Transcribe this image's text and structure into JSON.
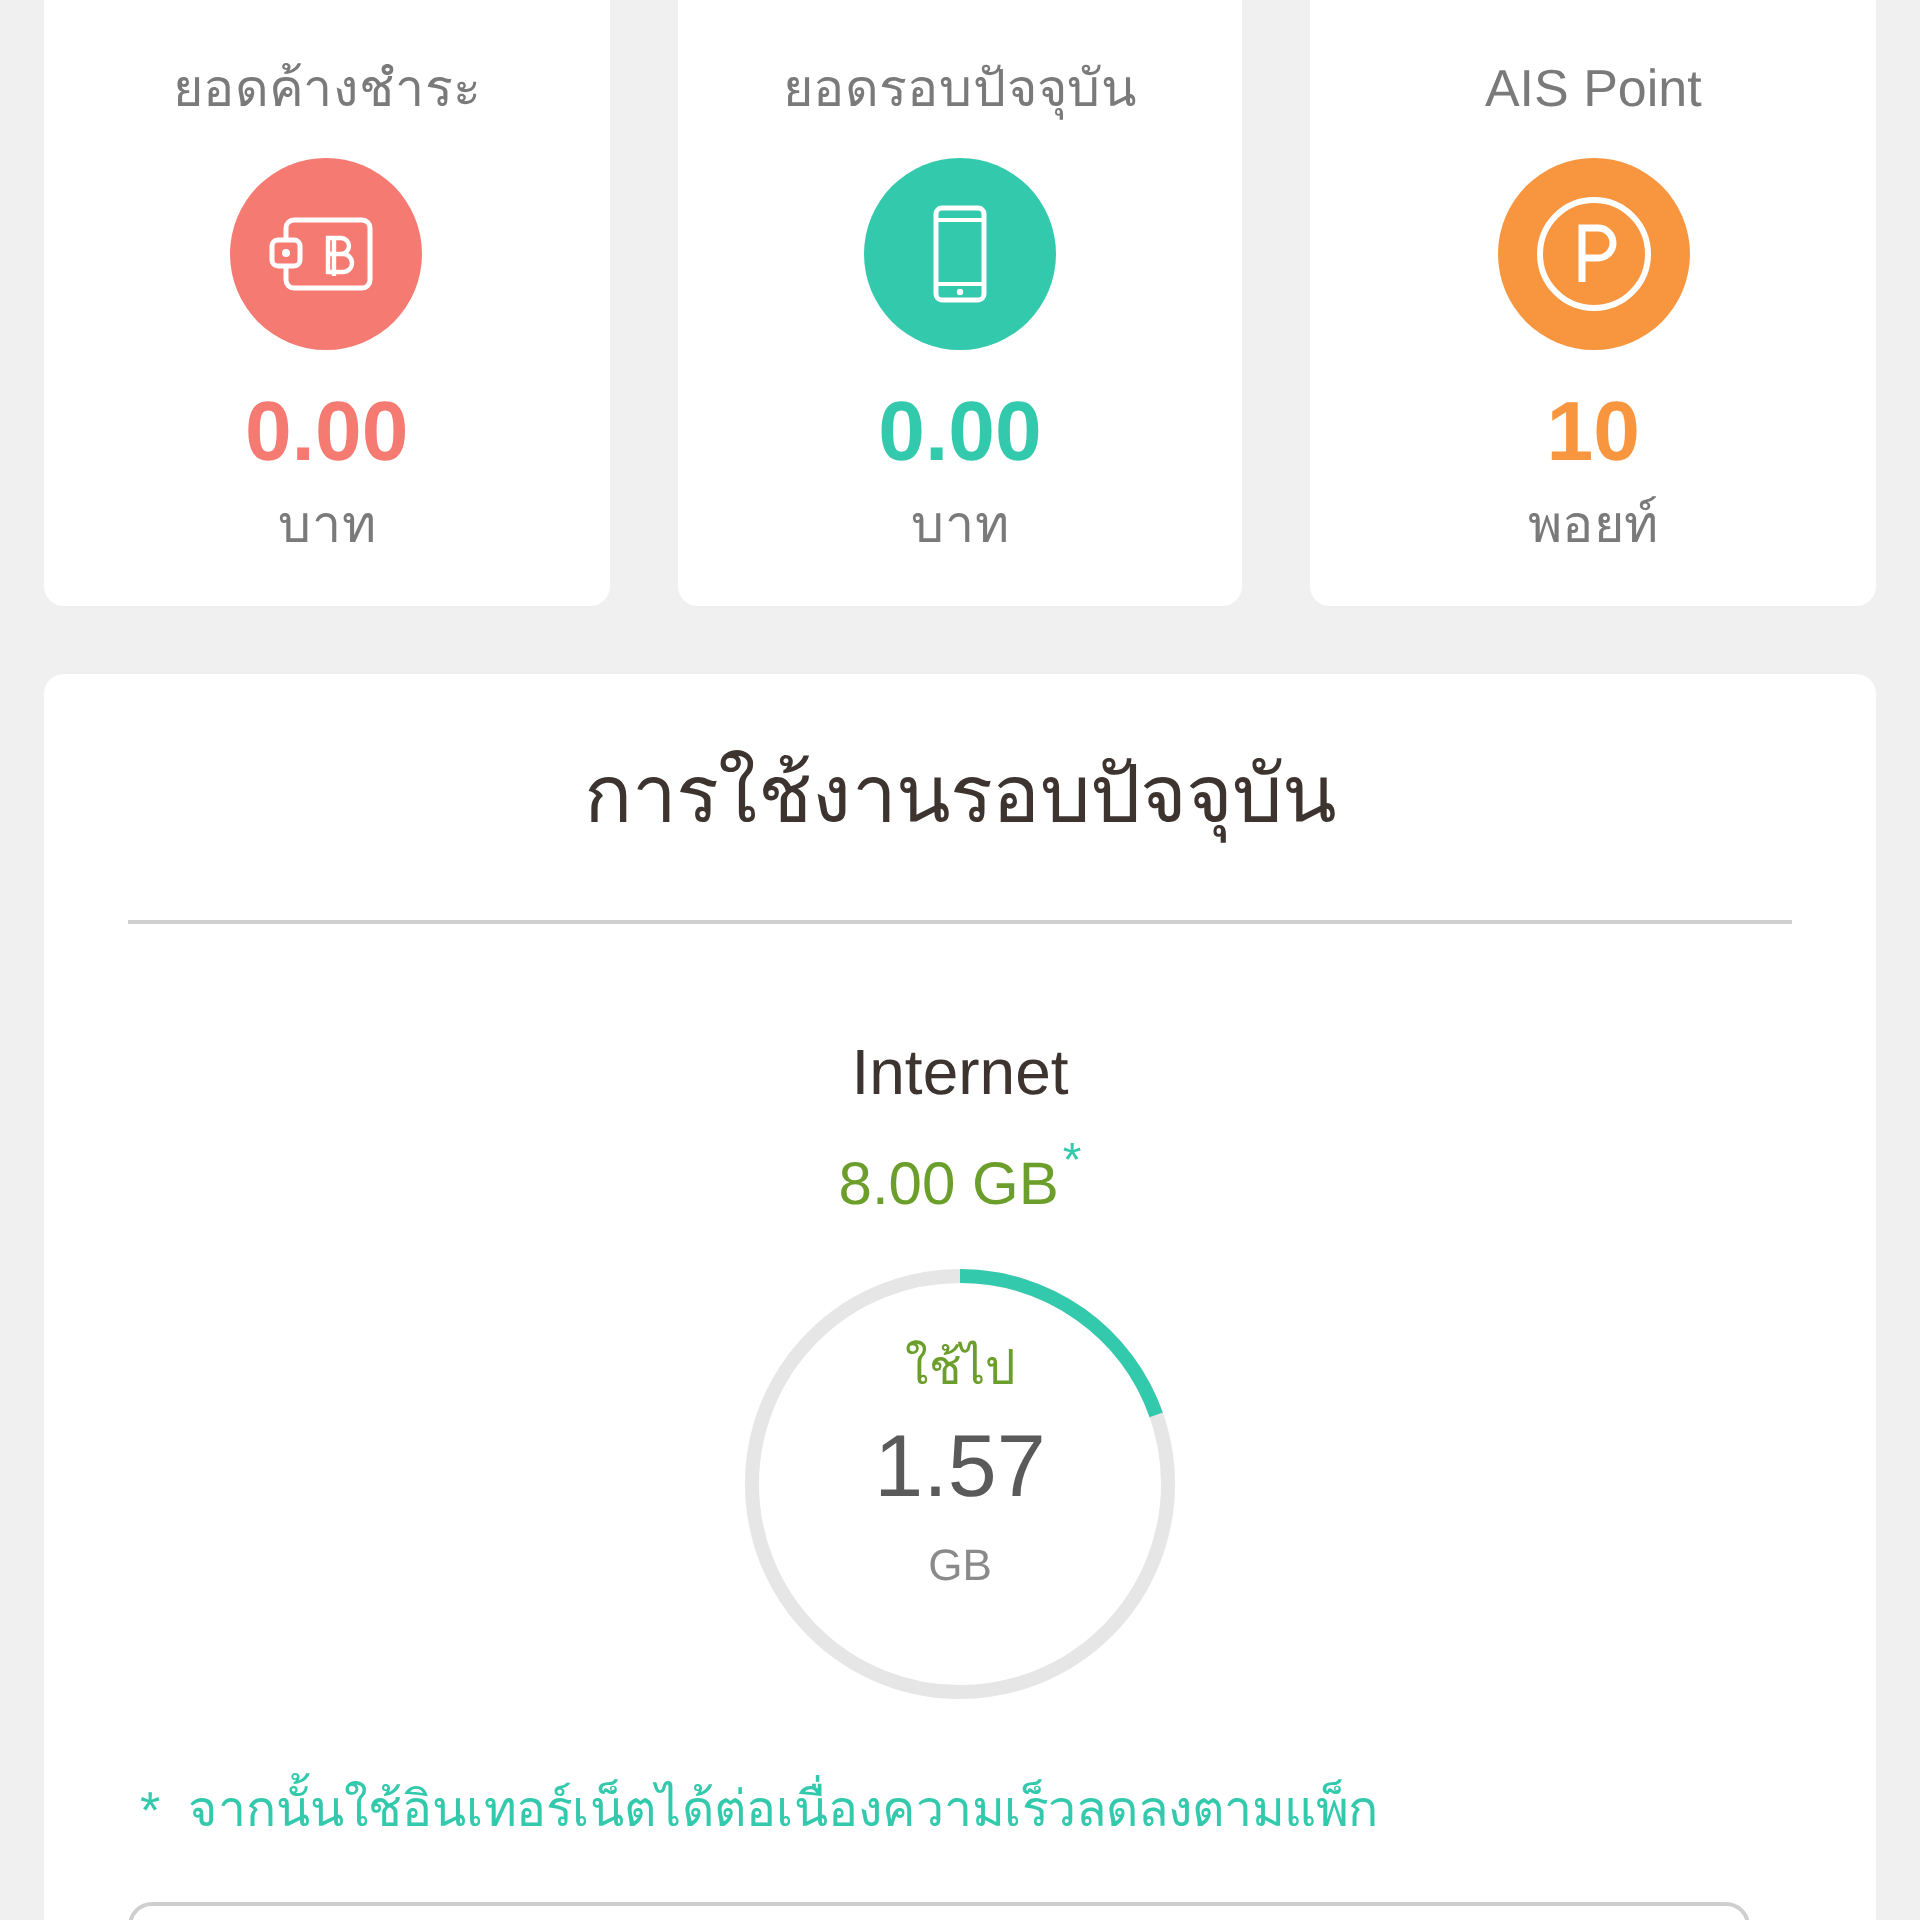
{
  "cards": [
    {
      "kind": "wallet",
      "title": "ยอดค้างชำระ",
      "value": "0.00",
      "unit": "บาท",
      "color": "#f47a72"
    },
    {
      "kind": "phone",
      "title": "ยอดรอบปัจจุบัน",
      "value": "0.00",
      "unit": "บาท",
      "color": "#33c9ac"
    },
    {
      "kind": "points",
      "title": "AIS Point",
      "value": "10",
      "unit": "พอยท์",
      "color": "#f7963f"
    }
  ],
  "usage": {
    "title": "การใช้งานรอบปัจจุบัน",
    "service": "Internet",
    "quota": {
      "value": "8.00 GB",
      "mark": "*"
    },
    "meter": {
      "label": "ใช้ไป",
      "value": "1.57",
      "unit": "GB",
      "level": 0.196
    },
    "footnote": {
      "mark": "*",
      "text": "จากนั้นใช้อินเทอร์เน็ตได้ต่อเนื่องความเร็วลดลงตามแพ็ก"
    }
  }
}
